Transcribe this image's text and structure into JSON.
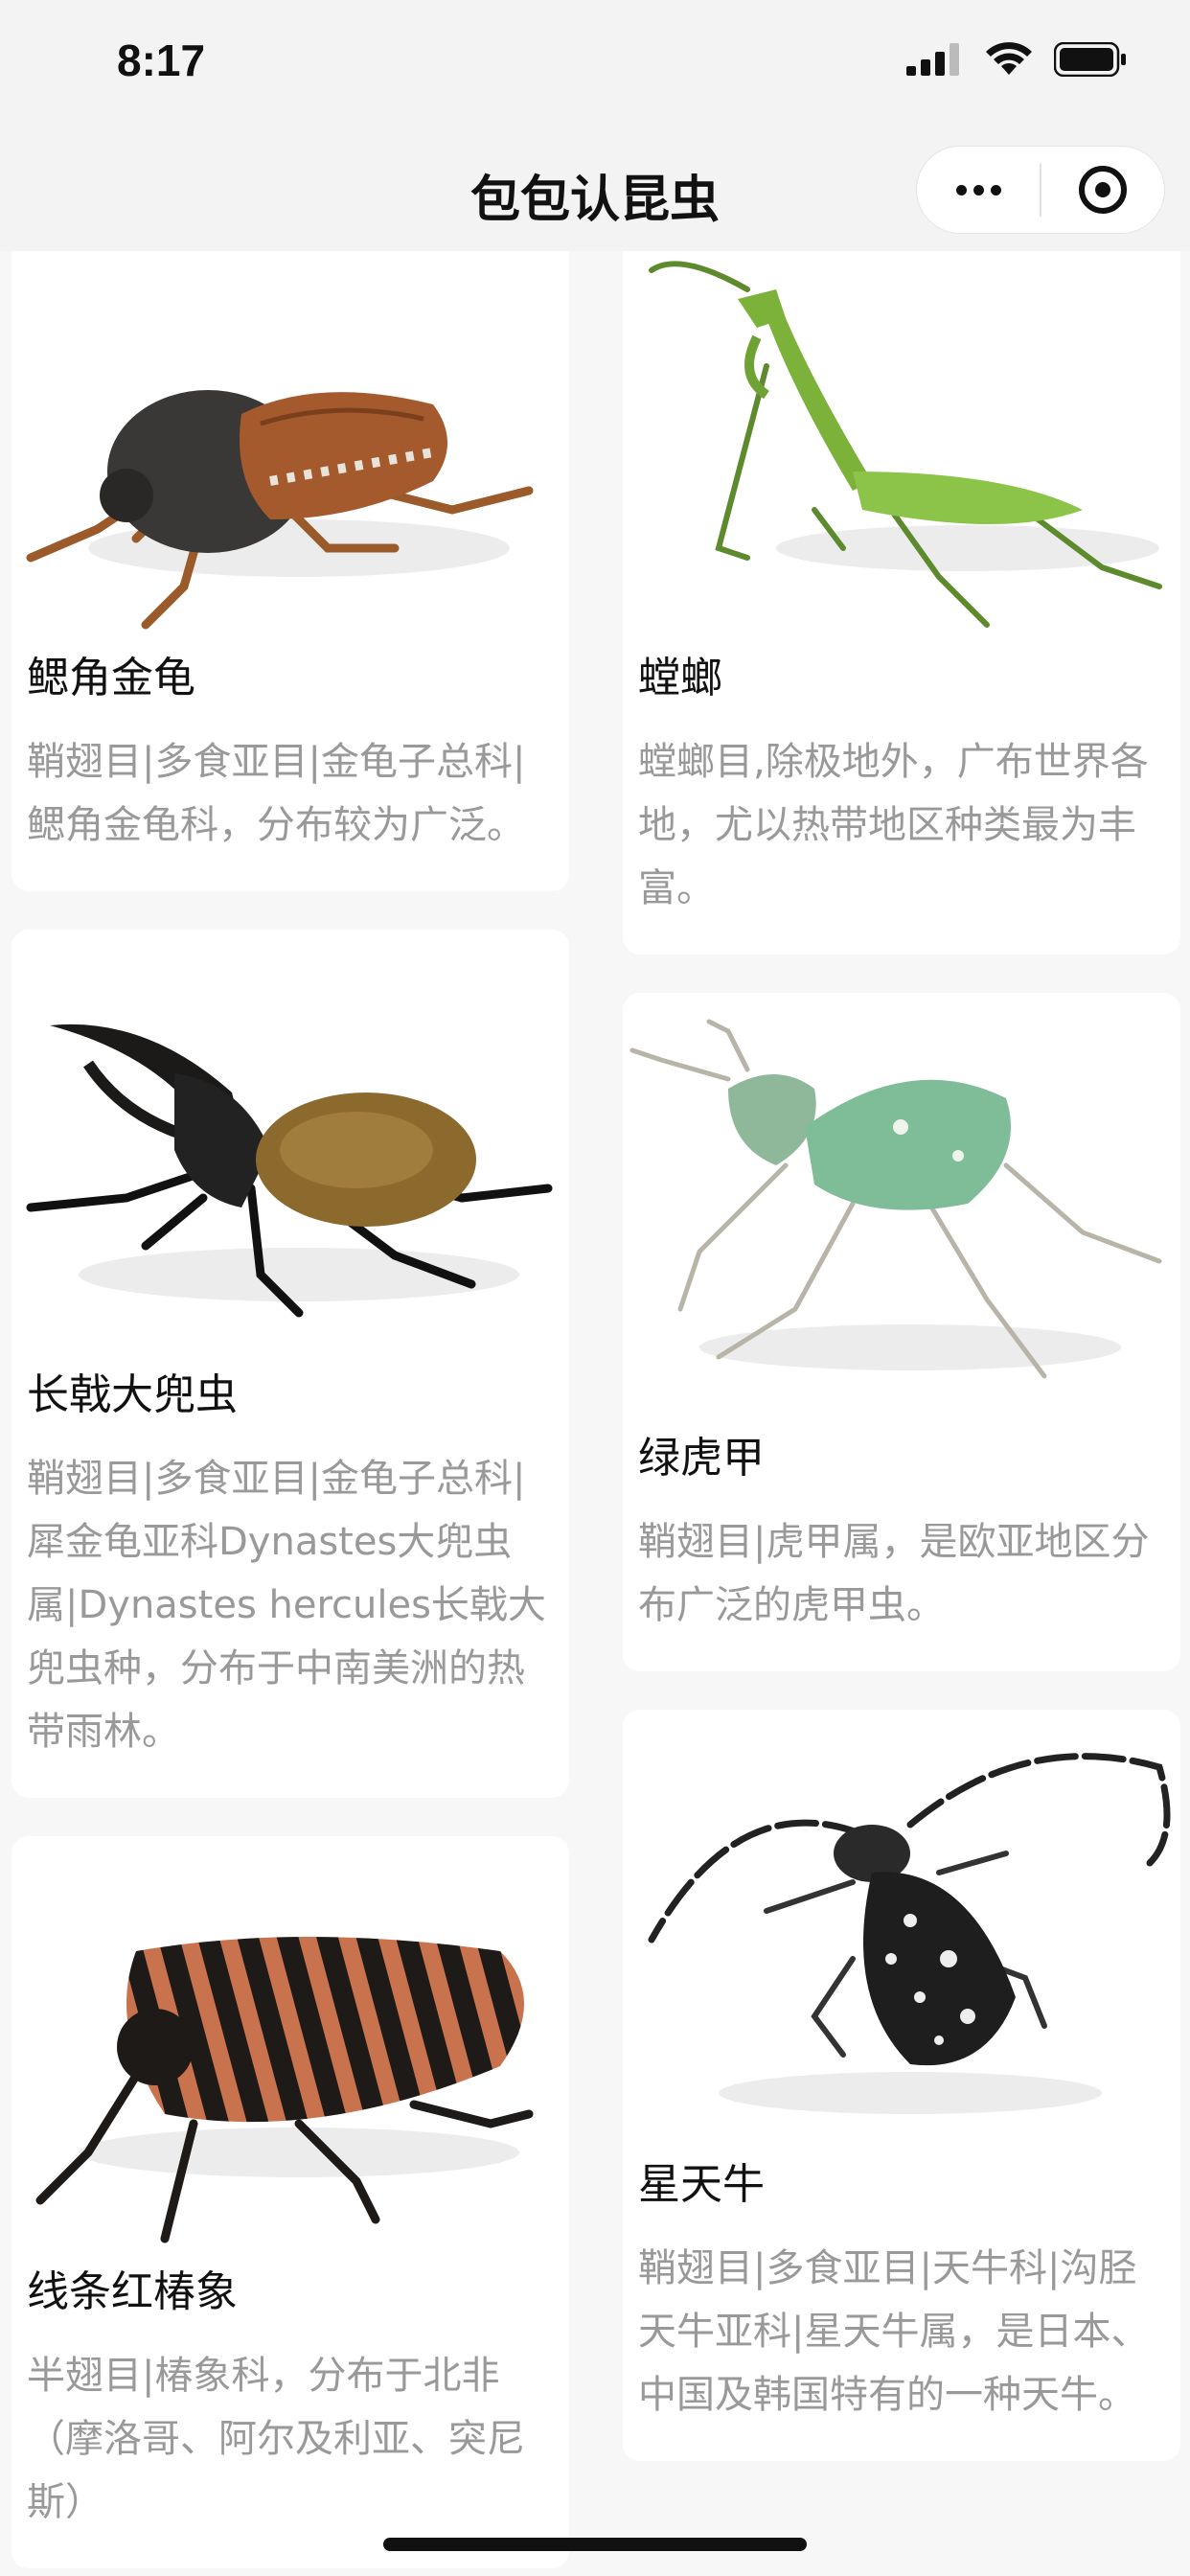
{
  "status": {
    "time": "8:17"
  },
  "nav": {
    "title": "包包认昆虫"
  },
  "cards": [
    {
      "name": "鳃角金龟",
      "desc": "鞘翅目|多食亚目|金龟子总科|鳃角金龟科，分布较为广泛。"
    },
    {
      "name": "螳螂",
      "desc": "螳螂目,除极地外，广布世界各地，尤以热带地区种类最为丰富。"
    },
    {
      "name": "长戟大兜虫",
      "desc": "鞘翅目|多食亚目|金龟子总科|犀金龟亚科Dynastes大兜虫属|Dynastes hercules长戟大兜虫种，分布于中南美洲的热带雨林。"
    },
    {
      "name": "绿虎甲",
      "desc": "鞘翅目|虎甲属，是欧亚地区分布广泛的虎甲虫。"
    },
    {
      "name": "线条红椿象",
      "desc": "半翅目|椿象科，分布于北非（摩洛哥、阿尔及利亚、突尼斯）"
    },
    {
      "name": "星天牛",
      "desc": "鞘翅目|多食亚目|天牛科|沟胫天牛亚科|星天牛属，是日本、中国及韩国特有的一种天牛。"
    }
  ]
}
